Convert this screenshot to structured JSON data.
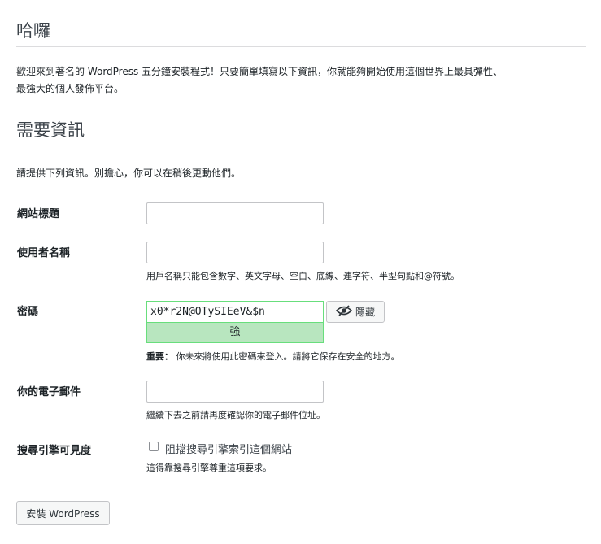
{
  "welcome": {
    "heading": "哈囉",
    "text_line1": "歡迎來到著名的 WordPress 五分鐘安裝程式！只要簡單填寫以下資訊，你就能夠開始使用這個世界上最具彈性、",
    "text_line2": "最強大的個人發佈平台。"
  },
  "info": {
    "heading": "需要資訊",
    "intro": "請提供下列資訊。別擔心，你可以在稍後更動他們。"
  },
  "fields": {
    "site_title": {
      "label": "網站標題",
      "value": ""
    },
    "username": {
      "label": "使用者名稱",
      "value": "",
      "help": "用戶名稱只能包含數字、英文字母、空白、底線、連字符、半型句點和@符號。"
    },
    "password": {
      "label": "密碼",
      "value": "x0*r2N@OTySIEeV&$n",
      "strength": "強",
      "hide_label": "隱藏",
      "important_label": "重要：",
      "important_text": "你未來將使用此密碼來登入。請將它保存在安全的地方。"
    },
    "email": {
      "label": "你的電子郵件",
      "value": "",
      "help": "繼續下去之前請再度確認你的電子郵件位址。"
    },
    "search_visibility": {
      "label": "搜尋引擎可見度",
      "checkbox_label": "阻擋搜尋引擎索引這個網站",
      "checked": false,
      "help": "這得靠搜尋引擎尊重這項要求。"
    }
  },
  "install_button": "安裝 WordPress",
  "colors": {
    "strong": "#b8e6bf",
    "strong_border": "#68de7c"
  }
}
